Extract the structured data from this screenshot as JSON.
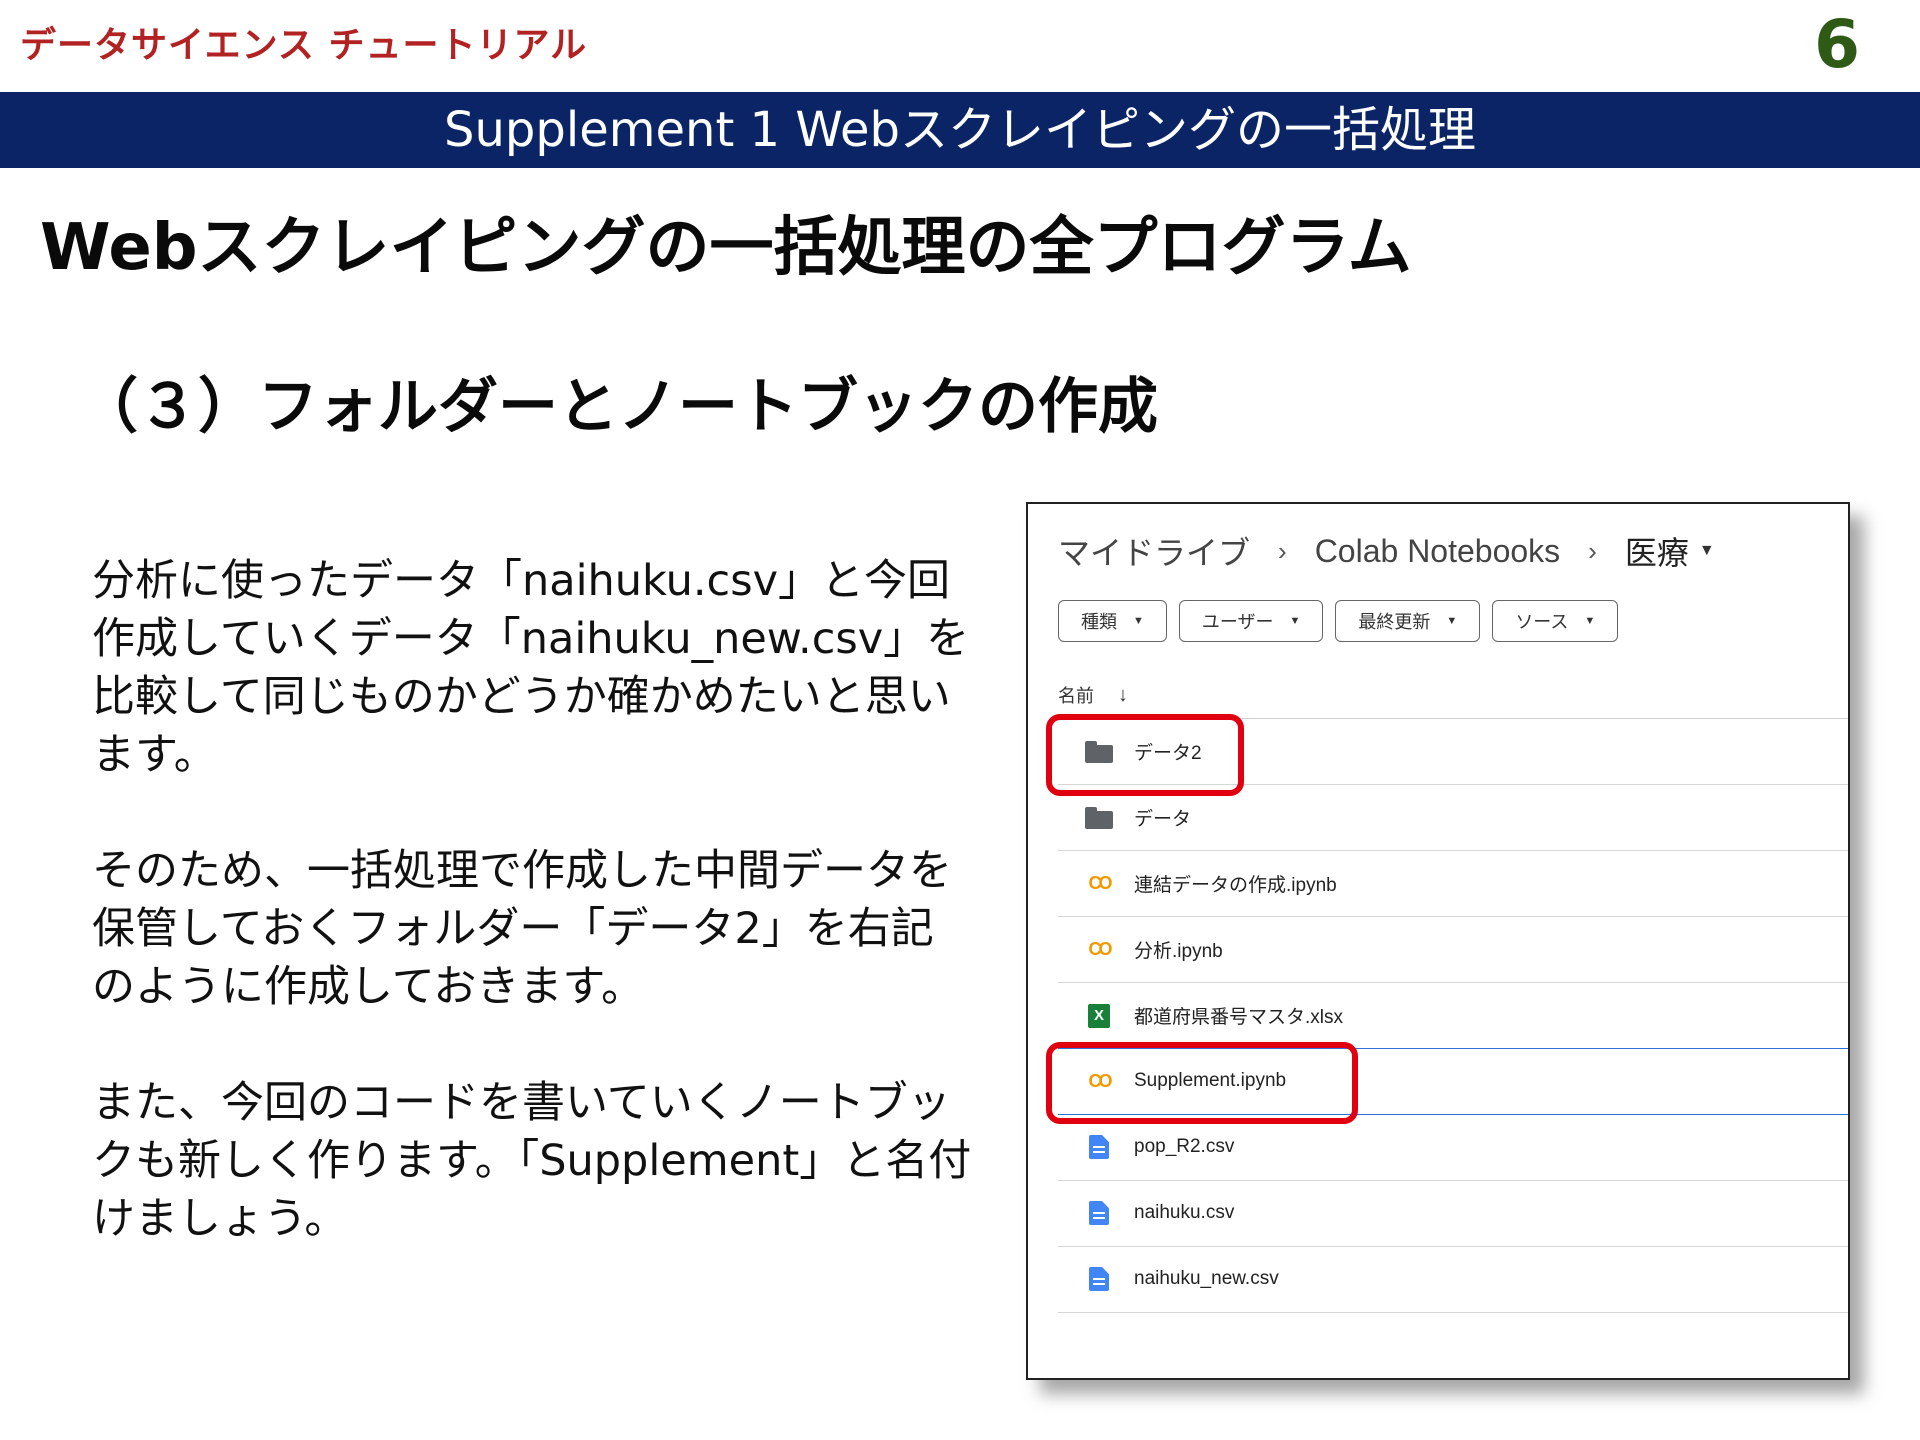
{
  "header": {
    "brand": "データサイエンス チュートリアル",
    "page_number": "6",
    "banner": "Supplement 1 Webスクレイピングの一括処理"
  },
  "main_title": "Webスクレイピングの一括処理の全プログラム",
  "sub_title": "（３）フォルダーとノートブックの作成",
  "body": {
    "p1": "分析に使ったデータ「naihuku.csv」と今回作成していくデータ「naihuku_new.csv」を比較して同じものかどうか確かめたいと思います。",
    "p2": "そのため、一括処理で作成した中間データを保管しておくフォルダー「データ2」を右記のように作成しておきます。",
    "p3": "また、今回のコードを書いていくノートブックも新しく作ります。「Supplement」と名付けましょう。"
  },
  "drive": {
    "breadcrumb": [
      "マイドライブ",
      "Colab Notebooks",
      "医療"
    ],
    "filters": [
      "種類",
      "ユーザー",
      "最終更新",
      "ソース"
    ],
    "column_header": "名前",
    "files": [
      {
        "name": "データ2",
        "icon": "folder-icon"
      },
      {
        "name": "データ",
        "icon": "folder-icon"
      },
      {
        "name": "連結データの作成.ipynb",
        "icon": "colab-icon"
      },
      {
        "name": "分析.ipynb",
        "icon": "colab-icon"
      },
      {
        "name": "都道府県番号マスタ.xlsx",
        "icon": "excel-icon",
        "icon_text": "X"
      },
      {
        "name": "Supplement.ipynb",
        "icon": "colab-icon"
      },
      {
        "name": "pop_R2.csv",
        "icon": "document-icon"
      },
      {
        "name": "naihuku.csv",
        "icon": "document-icon"
      },
      {
        "name": "naihuku_new.csv",
        "icon": "document-icon"
      }
    ],
    "highlight_color": "#e00010"
  }
}
